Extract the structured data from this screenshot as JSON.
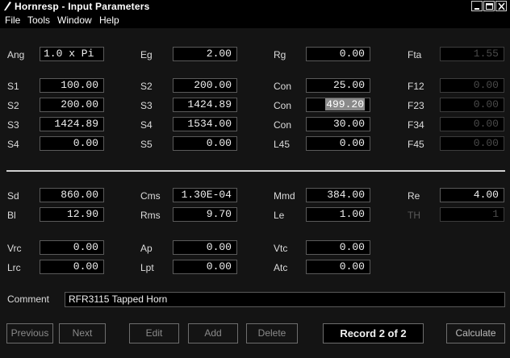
{
  "window": {
    "title": "Hornresp - Input Parameters"
  },
  "menu": [
    "File",
    "Tools",
    "Window",
    "Help"
  ],
  "params": {
    "ang": {
      "label": "Ang",
      "value": "1.0 x Pi"
    },
    "eg": {
      "label": "Eg",
      "value": "2.00"
    },
    "rg": {
      "label": "Rg",
      "value": "0.00"
    },
    "fta": {
      "label": "Fta",
      "value": "1.55"
    },
    "s1": {
      "label": "S1",
      "value": "100.00"
    },
    "s2a": {
      "label": "S2",
      "value": "200.00"
    },
    "con1": {
      "label": "Con",
      "value": "25.00"
    },
    "f12": {
      "label": "F12",
      "value": "0.00"
    },
    "s2b": {
      "label": "S2",
      "value": "200.00"
    },
    "s3a": {
      "label": "S3",
      "value": "1424.89"
    },
    "con2": {
      "label": "Con",
      "value": "499.20"
    },
    "f23": {
      "label": "F23",
      "value": "0.00"
    },
    "s3b": {
      "label": "S3",
      "value": "1424.89"
    },
    "s4a": {
      "label": "S4",
      "value": "1534.00"
    },
    "con3": {
      "label": "Con",
      "value": "30.00"
    },
    "f34": {
      "label": "F34",
      "value": "0.00"
    },
    "s4b": {
      "label": "S4",
      "value": "0.00"
    },
    "s5": {
      "label": "S5",
      "value": "0.00"
    },
    "l45": {
      "label": "L45",
      "value": "0.00"
    },
    "f45": {
      "label": "F45",
      "value": "0.00"
    },
    "sd": {
      "label": "Sd",
      "value": "860.00"
    },
    "cms": {
      "label": "Cms",
      "value": "1.30E-04"
    },
    "mmd": {
      "label": "Mmd",
      "value": "384.00"
    },
    "re": {
      "label": "Re",
      "value": "4.00"
    },
    "bl": {
      "label": "Bl",
      "value": "12.90"
    },
    "rms": {
      "label": "Rms",
      "value": "9.70"
    },
    "le": {
      "label": "Le",
      "value": "1.00"
    },
    "th": {
      "label": "TH",
      "value": "1"
    },
    "vrc": {
      "label": "Vrc",
      "value": "0.00"
    },
    "ap": {
      "label": "Ap",
      "value": "0.00"
    },
    "vtc": {
      "label": "Vtc",
      "value": "0.00"
    },
    "lrc": {
      "label": "Lrc",
      "value": "0.00"
    },
    "lpt": {
      "label": "Lpt",
      "value": "0.00"
    },
    "atc": {
      "label": "Atc",
      "value": "0.00"
    }
  },
  "comment": {
    "label": "Comment",
    "value": "RFR3115 Tapped Horn"
  },
  "buttons": {
    "previous": "Previous",
    "next": "Next",
    "edit": "Edit",
    "add": "Add",
    "delete": "Delete",
    "record": "Record 2 of 2",
    "calculate": "Calculate"
  }
}
